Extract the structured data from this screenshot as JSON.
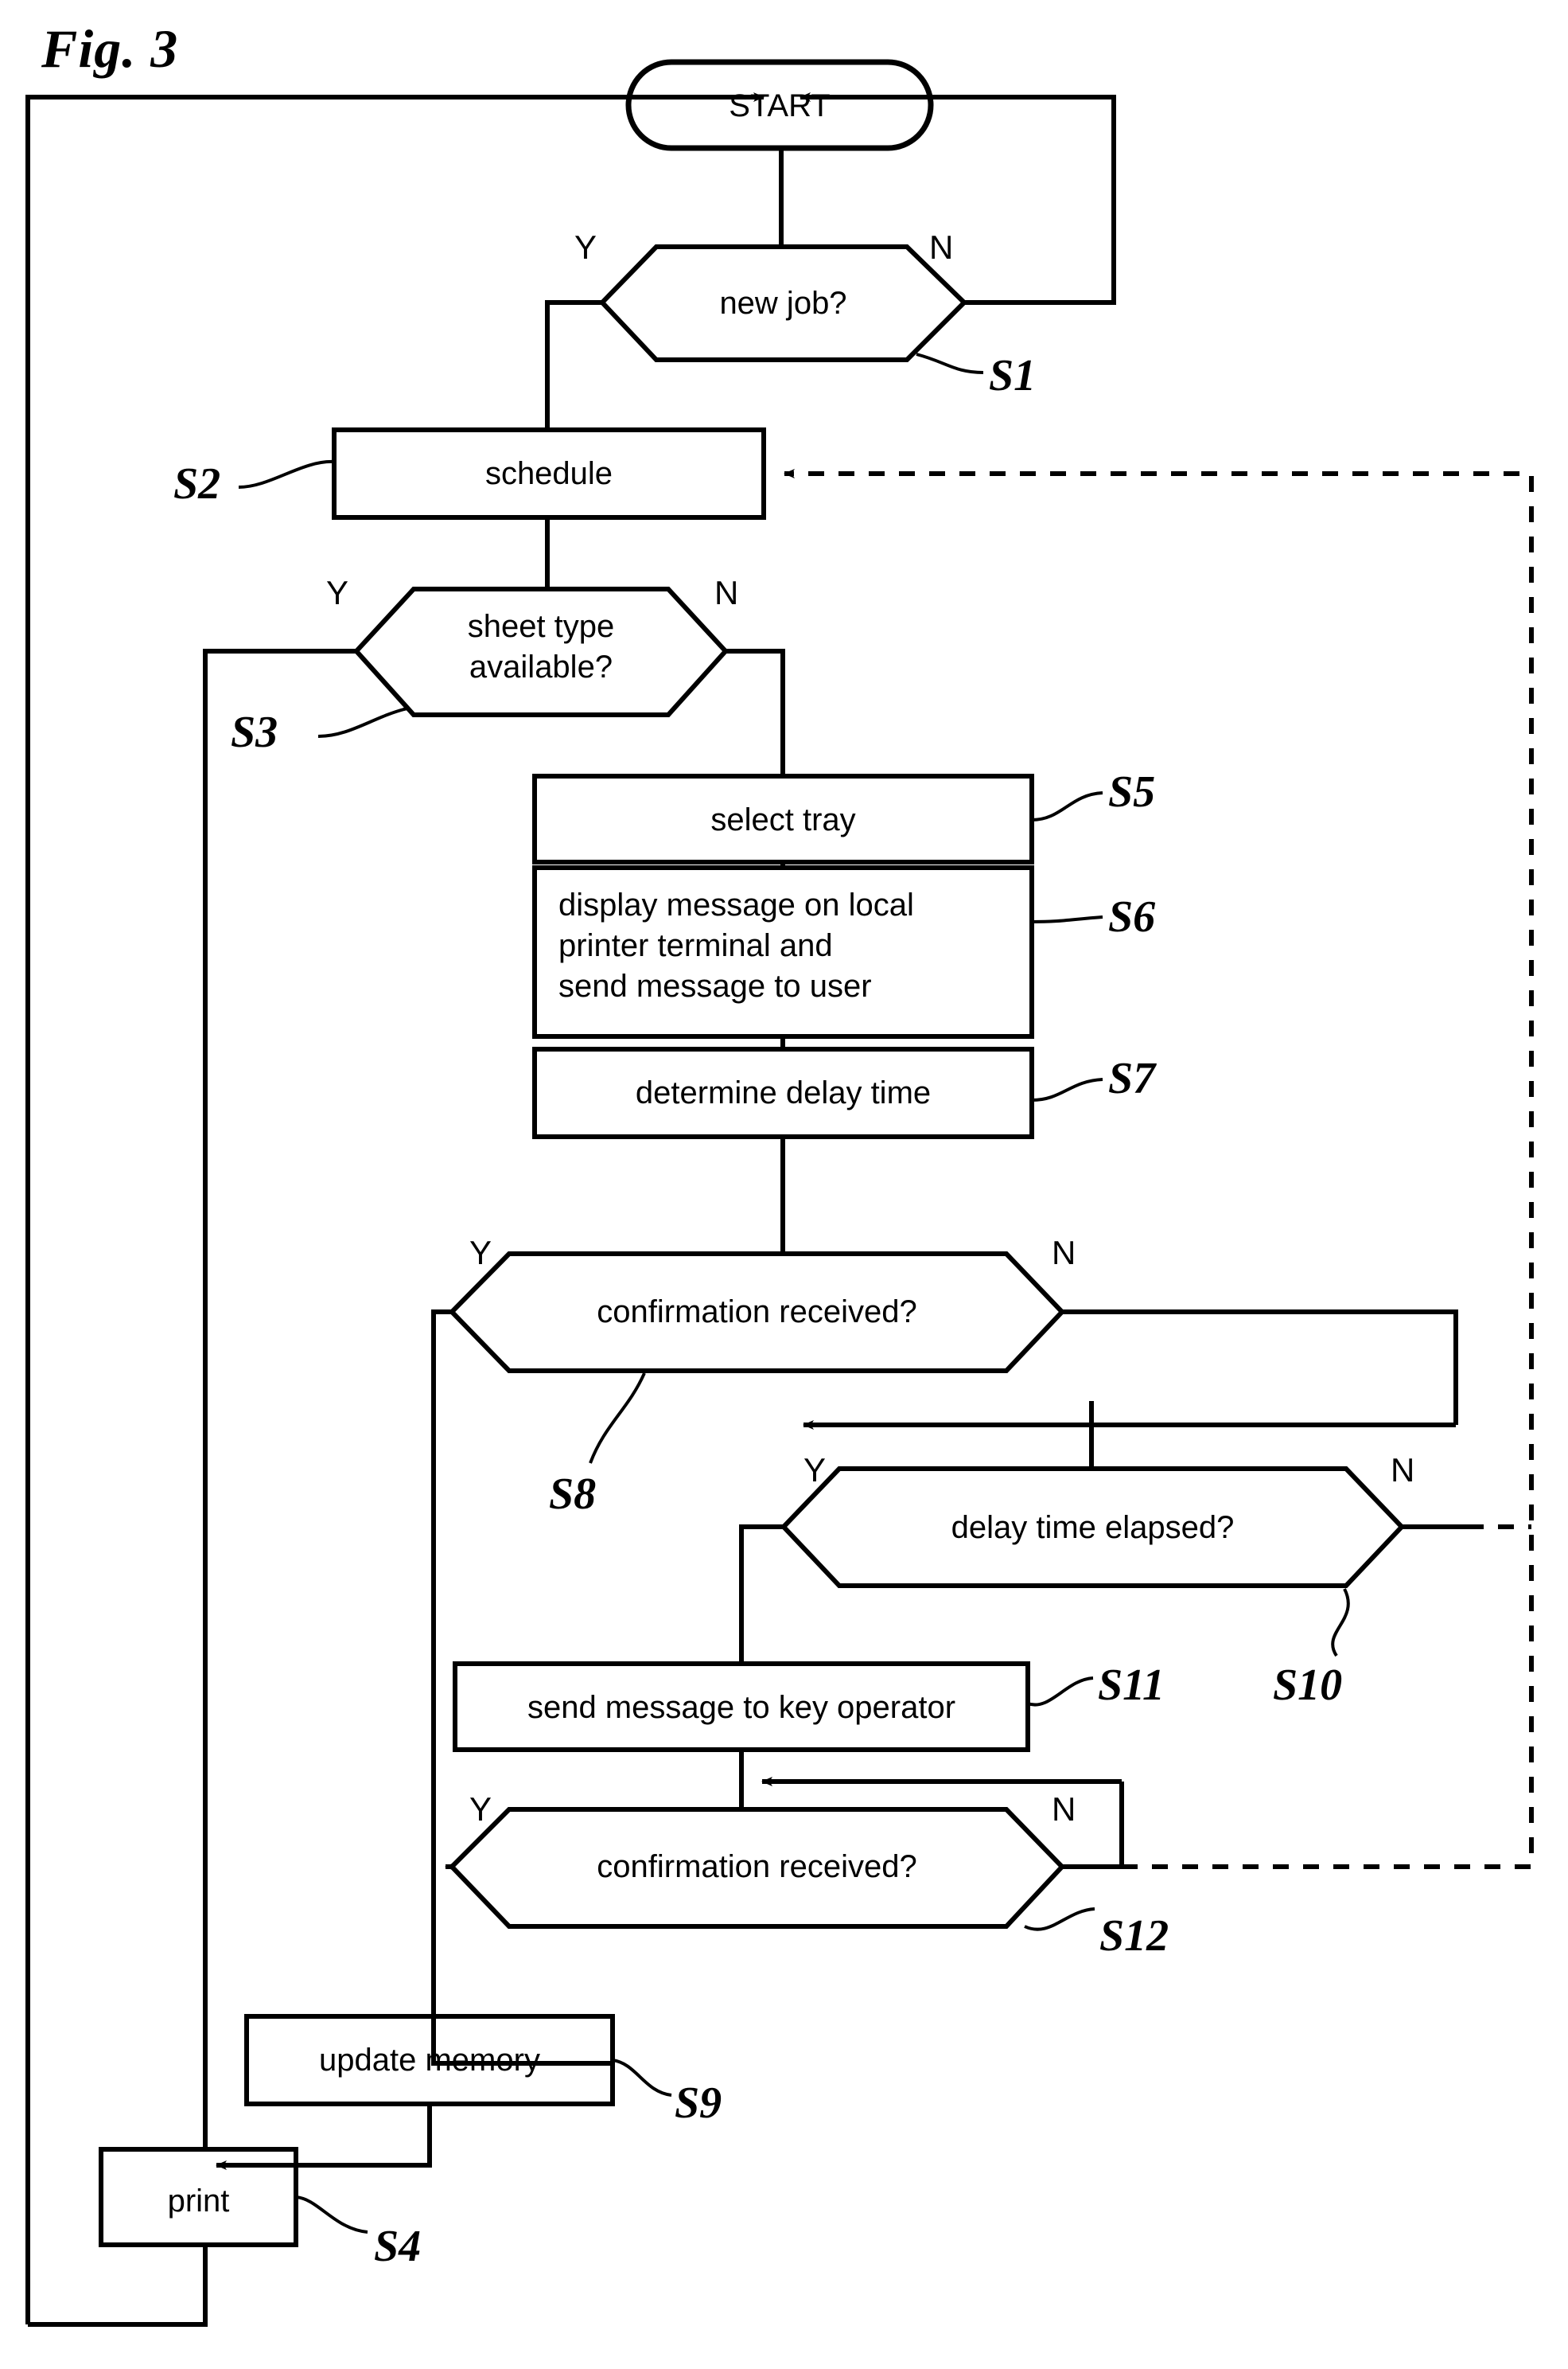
{
  "figure": {
    "label": "Fig. 3"
  },
  "nodes": {
    "start": {
      "text": "START",
      "shape": "terminator"
    },
    "s1": {
      "text": "new job?",
      "shape": "decision",
      "tag": "S1"
    },
    "s2": {
      "text": "schedule",
      "shape": "process",
      "tag": "S2"
    },
    "s3": {
      "text": "sheet type\navailable?",
      "shape": "decision",
      "tag": "S3"
    },
    "s4": {
      "text": "print",
      "shape": "process",
      "tag": "S4"
    },
    "s5": {
      "text": "select tray",
      "shape": "process",
      "tag": "S5"
    },
    "s6": {
      "text": "display message on local\nprinter terminal and\nsend message to user",
      "shape": "process",
      "tag": "S6"
    },
    "s7": {
      "text": "determine delay time",
      "shape": "process",
      "tag": "S7"
    },
    "s8": {
      "text": "confirmation received?",
      "shape": "decision",
      "tag": "S8"
    },
    "s9": {
      "text": "update memory",
      "shape": "process",
      "tag": "S9"
    },
    "s10": {
      "text": "delay time elapsed?",
      "shape": "decision",
      "tag": "S10"
    },
    "s11": {
      "text": "send message to key operator",
      "shape": "process",
      "tag": "S11"
    },
    "s12": {
      "text": "confirmation received?",
      "shape": "decision",
      "tag": "S12"
    }
  },
  "branch_labels": {
    "s1_yes": "Y",
    "s1_no": "N",
    "s3_yes": "Y",
    "s3_no": "N",
    "s8_yes": "Y",
    "s8_no": "N",
    "s10_yes": "Y",
    "s10_no": "N",
    "s12_yes": "Y",
    "s12_no": "N"
  },
  "colors": {
    "ink": "#000000",
    "paper": "#ffffff"
  }
}
